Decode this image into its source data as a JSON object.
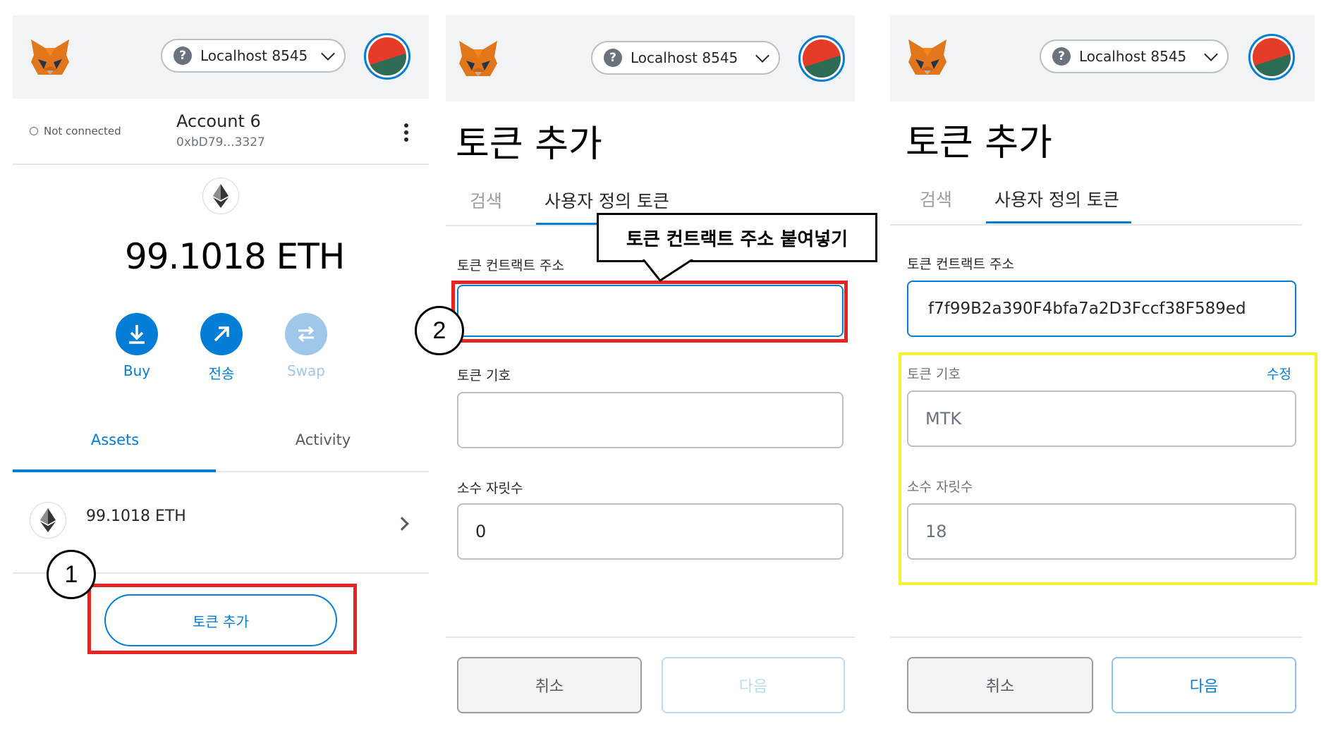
{
  "header": {
    "network_label": "Localhost 8545",
    "network_icon": "question-mark-icon",
    "logo_icon": "metamask-fox-icon",
    "avatar_colors": [
      "#e53c2a",
      "#2e6b55"
    ]
  },
  "panel1": {
    "connection_status": "Not connected",
    "account_name": "Account 6",
    "account_address": "0xbD79...3327",
    "balance": "99.1018 ETH",
    "actions": [
      {
        "label": "Buy",
        "icon": "download-icon",
        "enabled": true
      },
      {
        "label": "전송",
        "icon": "arrow-up-right-icon",
        "enabled": true
      },
      {
        "label": "Swap",
        "icon": "swap-icon",
        "enabled": false
      }
    ],
    "tabs": [
      "Assets",
      "Activity"
    ],
    "active_tab": "Assets",
    "asset_row": "99.1018 ETH",
    "add_token_button": "토큰 추가"
  },
  "panel2": {
    "title": "토큰 추가",
    "tabs": [
      "검색",
      "사용자 정의 토큰"
    ],
    "active_tab": "사용자 정의 토큰",
    "address_label": "토큰 컨트랙트 주소",
    "address_value": "",
    "symbol_label": "토큰 기호",
    "symbol_value": "",
    "decimals_label": "소수 자릿수",
    "decimals_value": "0",
    "cancel_button": "취소",
    "next_button": "다음"
  },
  "panel3": {
    "title": "토큰 추가",
    "tabs": [
      "검색",
      "사용자 정의 토큰"
    ],
    "active_tab": "사용자 정의 토큰",
    "address_label": "토큰 컨트랙트 주소",
    "address_value": "f7f99B2a390F4bfa7a2D3Fccf38F589ed",
    "symbol_label": "토큰 기호",
    "edit_link": "수정",
    "symbol_value": "MTK",
    "decimals_label": "소수 자릿수",
    "decimals_value": "18",
    "cancel_button": "취소",
    "next_button": "다음"
  },
  "annotations": {
    "step1": "1",
    "step2": "2",
    "callout": "토큰 컨트랙트 주소 붙여넣기",
    "highlight_red": "#e52424",
    "highlight_yellow": "#f8f22a"
  },
  "colors": {
    "accent": "#037dd6",
    "header_bg": "#f2f3f4"
  }
}
